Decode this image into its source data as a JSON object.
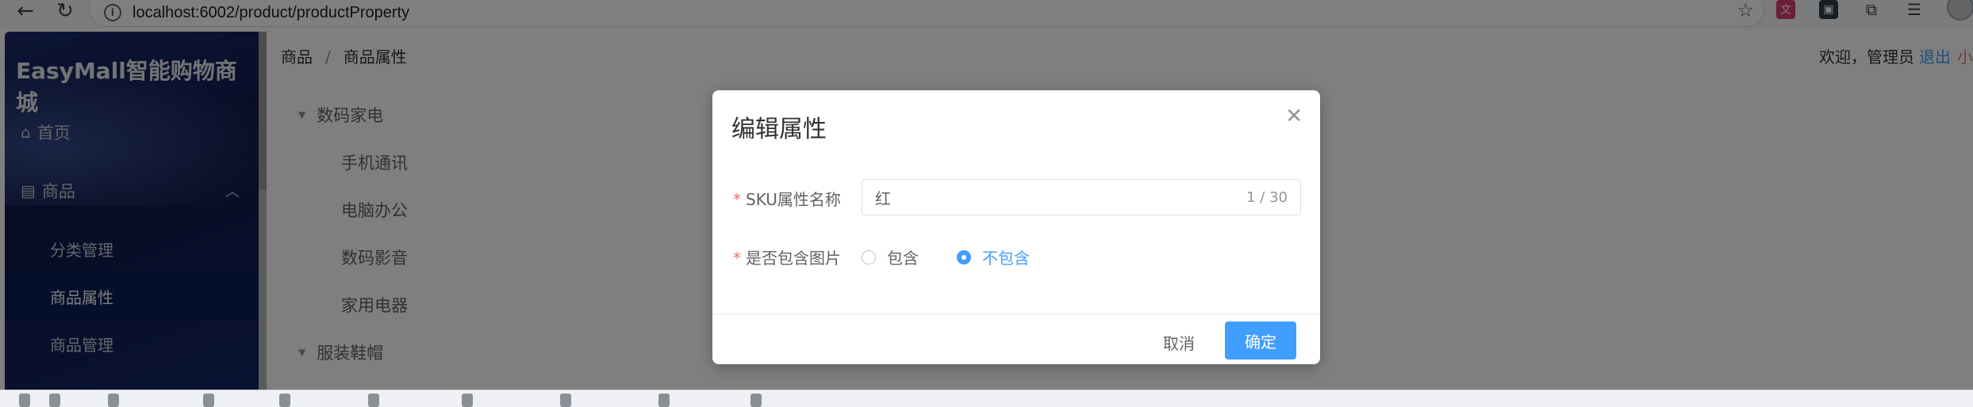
{
  "browser": {
    "url": "localhost:6002/product/productProperty"
  },
  "app": {
    "logo": "EasyMall智能购物商城",
    "sidebar": {
      "home_label": "首页",
      "goods_label": "商品",
      "sub_items": [
        "分类管理",
        "商品属性",
        "商品管理"
      ],
      "active_sub": "商品属性"
    },
    "header": {
      "breadcrumb": [
        "商品",
        "商品属性"
      ],
      "welcome": "欢迎，管理员",
      "logout": "退出",
      "user": "小"
    },
    "tree": {
      "category_1": "数码家电",
      "children": [
        "手机通讯",
        "电脑办公",
        "数码影音",
        "家用电器"
      ],
      "category_2": "服装鞋帽"
    }
  },
  "dialog": {
    "title": "编辑属性",
    "sku_label": "SKU属性名称",
    "sku_value": "红",
    "sku_count": "1 / 30",
    "image_label": "是否包含图片",
    "radio_options": [
      "包含",
      "不包含"
    ],
    "radio_selected": "不包含",
    "cancel_label": "取消",
    "confirm_label": "确定"
  },
  "colors": {
    "primary": "#409eff",
    "required": "#f56c6c",
    "sidebar_bg": "#0d1a4a"
  }
}
